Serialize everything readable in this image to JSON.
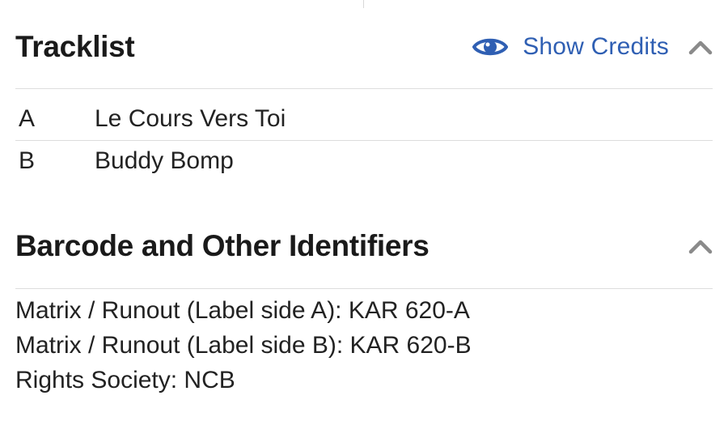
{
  "tracklist": {
    "title": "Tracklist",
    "show_credits_label": "Show Credits",
    "tracks": [
      {
        "position": "A",
        "title": "Le Cours Vers Toi"
      },
      {
        "position": "B",
        "title": "Buddy Bomp"
      }
    ]
  },
  "identifiers": {
    "title": "Barcode and Other Identifiers",
    "lines": [
      "Matrix / Runout (Label side A): KAR 620-A",
      "Matrix / Runout (Label side B): KAR 620-B",
      "Rights Society: NCB"
    ]
  },
  "colors": {
    "link": "#2f5fb3",
    "eye_icon": "#2f5fb3",
    "chevron": "#8a8a8a",
    "divider": "#dddddd"
  },
  "icons": [
    "eye-icon",
    "chevron-up-icon"
  ]
}
